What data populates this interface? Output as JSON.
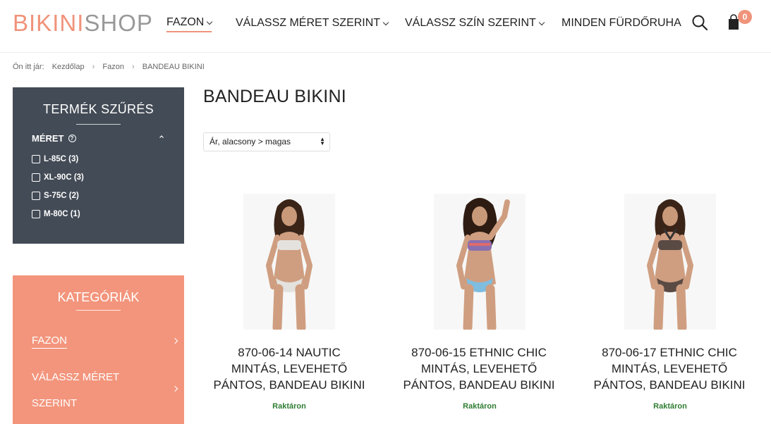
{
  "header": {
    "logo_part1": "BIKINI",
    "logo_part2": "SHOP",
    "nav": [
      {
        "label": "FAZON"
      },
      {
        "label": "VÁLASSZ MÉRET SZERINT"
      },
      {
        "label": "VÁLASSZ SZÍN SZERINT"
      },
      {
        "label": "MINDEN FÜRDŐRUHA"
      }
    ],
    "cart_count": "0"
  },
  "breadcrumb": {
    "prefix": "Ön itt jár:",
    "items": [
      "Kezdőlap",
      "Fazon",
      "BANDEAU BIKINI"
    ]
  },
  "filter": {
    "title": "TERMÉK SZŰRÉS",
    "size_label": "MÉRET",
    "options": [
      "L-85C (3)",
      "XL-90C (3)",
      "S-75C (2)",
      "M-80C (1)"
    ]
  },
  "categories": {
    "title": "KATEGÓRIÁK",
    "items": [
      "FAZON",
      "VÁLASSZ MÉRET",
      "SZERINT"
    ]
  },
  "main": {
    "title": "BANDEAU BIKINI",
    "sort_value": "Ár, alacsony > magas",
    "products": [
      {
        "name_lines": [
          "870-06-14 NAUTIC",
          "MINTÁS, LEVEHETŐ",
          "PÁNTOS, BANDEAU BIKINI"
        ],
        "stock": "Raktáron"
      },
      {
        "name_lines": [
          "870-06-15 ETHNIC CHIC",
          "MINTÁS, LEVEHETŐ",
          "PÁNTOS, BANDEAU BIKINI"
        ],
        "stock": "Raktáron"
      },
      {
        "name_lines": [
          "870-06-17 ETHNIC CHIC",
          "MINTÁS, LEVEHETŐ",
          "PÁNTOS, BANDEAU BIKINI"
        ],
        "stock": "Raktáron"
      }
    ]
  },
  "colors": {
    "accent": "#f0937a",
    "filter_bg": "#434b56",
    "category_bg": "#f3957c",
    "stock_green": "#2e7d32"
  }
}
